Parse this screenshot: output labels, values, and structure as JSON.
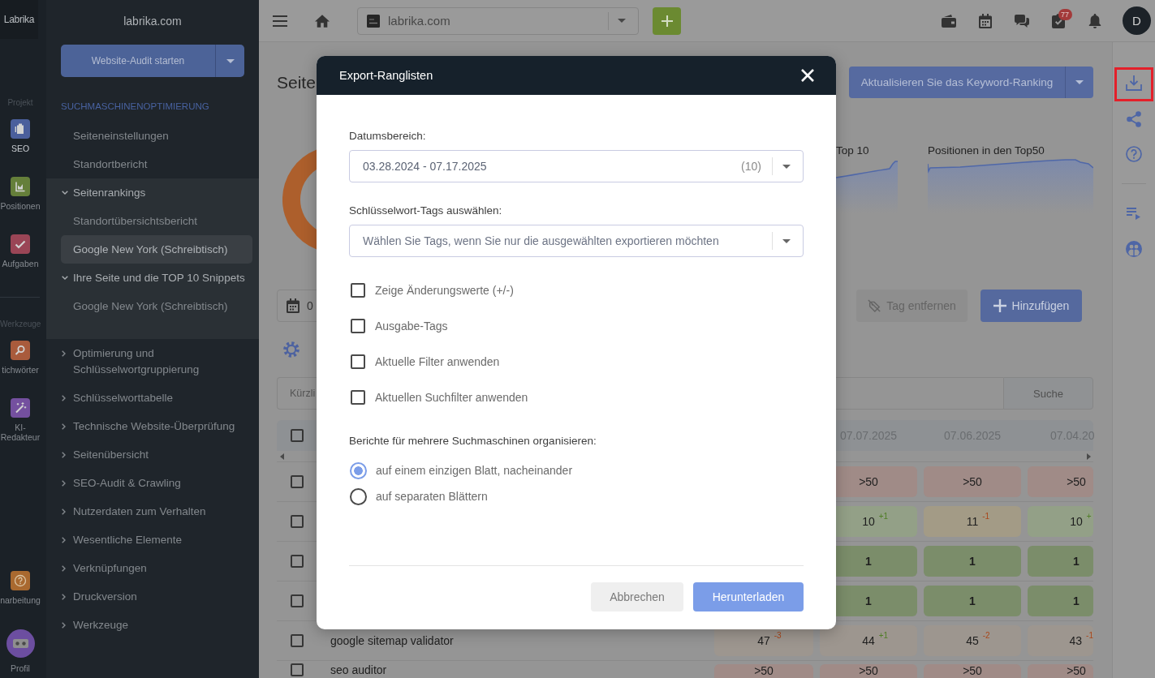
{
  "rail": {
    "logo": "Labrika",
    "groups": [
      {
        "title": "Projekt",
        "items": [
          {
            "label": "SEO",
            "color": "#4b5f9c",
            "selected": true
          },
          {
            "label": "Positionen",
            "color": "#657f3a",
            "selected": false
          },
          {
            "label": "Aufgaben",
            "color": "#9a4556",
            "selected": false
          }
        ]
      },
      {
        "title": "Werkzeuge",
        "items": [
          {
            "label": "tichwörter",
            "color": "#a95b3c",
            "selected": false
          },
          {
            "label": "KI-Redakteur",
            "color": "#74509f",
            "selected": false
          }
        ]
      }
    ],
    "footer": [
      {
        "kind": "tile",
        "label": "narbeitung",
        "color": "#a9692f",
        "selected": false
      },
      {
        "kind": "avatar",
        "label": "Profil",
        "selected": false
      }
    ]
  },
  "sidebar": {
    "project": "labrika.com",
    "audit_button": "Website-Audit starten",
    "section": "SUCHMASCHINENOPTIMIERUNG",
    "items": [
      {
        "kind": "link",
        "label": "Seiteneinstellungen"
      },
      {
        "kind": "link",
        "label": "Standortbericht"
      },
      {
        "kind": "group",
        "label": "Seitenrankings",
        "expanded": true,
        "children": [
          {
            "label": "Standortübersichtsbericht",
            "selected": false
          },
          {
            "label": "Google New York (Schreibtisch)",
            "selected": true
          }
        ]
      },
      {
        "kind": "group",
        "label": "Ihre Seite und die TOP 10 Snippets",
        "expanded": true,
        "children": [
          {
            "label": "Google New York (Schreibtisch)",
            "selected": false
          }
        ]
      },
      {
        "kind": "group",
        "label": "Optimierung und Schlüsselwortgruppierung",
        "expanded": false
      },
      {
        "kind": "group",
        "label": "Schlüsselworttabelle",
        "expanded": false
      },
      {
        "kind": "group",
        "label": "Technische Website-Überprüfung",
        "expanded": false
      },
      {
        "kind": "group",
        "label": "Seitenübersicht",
        "expanded": false
      },
      {
        "kind": "group",
        "label": "SEO-Audit & Crawling",
        "expanded": false
      },
      {
        "kind": "group",
        "label": "Nutzerdaten zum Verhalten",
        "expanded": false
      },
      {
        "kind": "group",
        "label": "Wesentliche Elemente",
        "expanded": false
      },
      {
        "kind": "group",
        "label": "Verknüpfungen",
        "expanded": false
      },
      {
        "kind": "group",
        "label": "Druckversion",
        "expanded": false
      },
      {
        "kind": "group",
        "label": "Werkzeuge",
        "expanded": false
      }
    ]
  },
  "topbar": {
    "project": "labrika.com",
    "tasks_badge": "77",
    "avatar": "D"
  },
  "toolbar": [
    {
      "highlighted": true
    },
    {
      "highlighted": false
    },
    {
      "highlighted": false
    },
    {
      "highlighted": false
    },
    {
      "highlighted": false
    }
  ],
  "page": {
    "title": "Seite",
    "update_button": "Aktualisieren Sie das Keyword-Ranking",
    "sparklines": [
      {
        "title": "Top 10"
      },
      {
        "title": "Positionen in den Top50"
      }
    ],
    "date_field": {
      "value": "0"
    },
    "actions": [
      {
        "kind": "secondary",
        "label": "Tag entfernen"
      },
      {
        "kind": "primary",
        "label": "Hinzufügen"
      }
    ],
    "search": {
      "placeholder": "Kürzli",
      "button": "Suche"
    },
    "table": {
      "select_all": false,
      "columns": [
        "07.07.2025",
        "07.06.2025",
        "07.04.20"
      ],
      "rows": [
        {
          "checked": false,
          "cells": [
            {
              "kind": "plain",
              "value": ">50",
              "color": "#a08b87"
            },
            {
              "kind": "plain",
              "value": ">50",
              "color": "#a08b87"
            },
            {
              "kind": "plain",
              "value": ">50",
              "color": "#a08b87"
            }
          ]
        },
        {
          "checked": false,
          "cells": [
            {
              "kind": "plain",
              "value": "10",
              "change": "+1",
              "improved": true,
              "color": "#93a087"
            },
            {
              "kind": "plain",
              "value": "11",
              "change": "-1",
              "improved": false,
              "color": "#a39b86"
            },
            {
              "kind": "plain",
              "value": "10",
              "change": "+",
              "improved": true,
              "color": "#93a087"
            }
          ]
        },
        {
          "checked": false,
          "cells": [
            {
              "kind": "top",
              "value": "1",
              "color": "#7b8d6a"
            },
            {
              "kind": "top",
              "value": "1",
              "color": "#7b8d6a"
            },
            {
              "kind": "top",
              "value": "1",
              "color": "#7b8d6a"
            }
          ]
        },
        {
          "checked": false,
          "cells": [
            {
              "kind": "top",
              "value": "1",
              "color": "#7b8d6a"
            },
            {
              "kind": "top",
              "value": "1",
              "color": "#7b8d6a"
            },
            {
              "kind": "top",
              "value": "1",
              "color": "#7b8d6a"
            }
          ]
        },
        {
          "checked": false,
          "keyword": "google sitemap validator",
          "cells": [
            {
              "kind": "plain",
              "value": "47",
              "change": "-3",
              "improved": false,
              "color": "#9d968f"
            },
            {
              "kind": "plain",
              "value": "44",
              "change": "+1",
              "improved": true,
              "color": "#9d968f"
            },
            {
              "kind": "plain",
              "value": "45",
              "change": "-2",
              "improved": false,
              "color": "#9d968f"
            },
            {
              "kind": "plain",
              "value": "43",
              "change": "-1",
              "improved": false,
              "color": "#9d968f"
            }
          ]
        },
        {
          "checked": false,
          "keyword": "seo auditor",
          "cells": [
            {
              "kind": "plain",
              "value": ">50",
              "color": "#a08b87"
            },
            {
              "kind": "plain",
              "value": ">50",
              "color": "#a08b87"
            },
            {
              "kind": "plain",
              "value": ">50",
              "color": "#a08b87"
            },
            {
              "kind": "plain",
              "value": ">50",
              "color": "#a08b87"
            }
          ]
        }
      ]
    }
  },
  "dialog": {
    "title": "Export-Ranglisten",
    "date_range": {
      "label": "Datumsbereich:",
      "value": "03.28.2024 - 07.17.2025",
      "count": "(10)"
    },
    "tags": {
      "label": "Schlüsselwort-Tags auswählen:",
      "placeholder": "Wählen Sie Tags, wenn Sie nur die ausgewählten exportieren möchten"
    },
    "options": [
      {
        "label": "Zeige Änderungswerte (+/-)",
        "checked": false
      },
      {
        "label": "Ausgabe-Tags",
        "checked": false
      },
      {
        "label": "Aktuelle Filter anwenden",
        "checked": false
      },
      {
        "label": "Aktuellen Suchfilter anwenden",
        "checked": false
      }
    ],
    "layout": {
      "label": "Berichte für mehrere Suchmaschinen organisieren:",
      "choices": [
        {
          "label": "auf einem einzigen Blatt, nacheinander",
          "selected": true
        },
        {
          "label": "auf separaten Blättern",
          "selected": false
        }
      ]
    },
    "buttons": [
      {
        "kind": "secondary",
        "label": "Abbrechen"
      },
      {
        "kind": "primary",
        "label": "Herunterladen"
      }
    ]
  }
}
